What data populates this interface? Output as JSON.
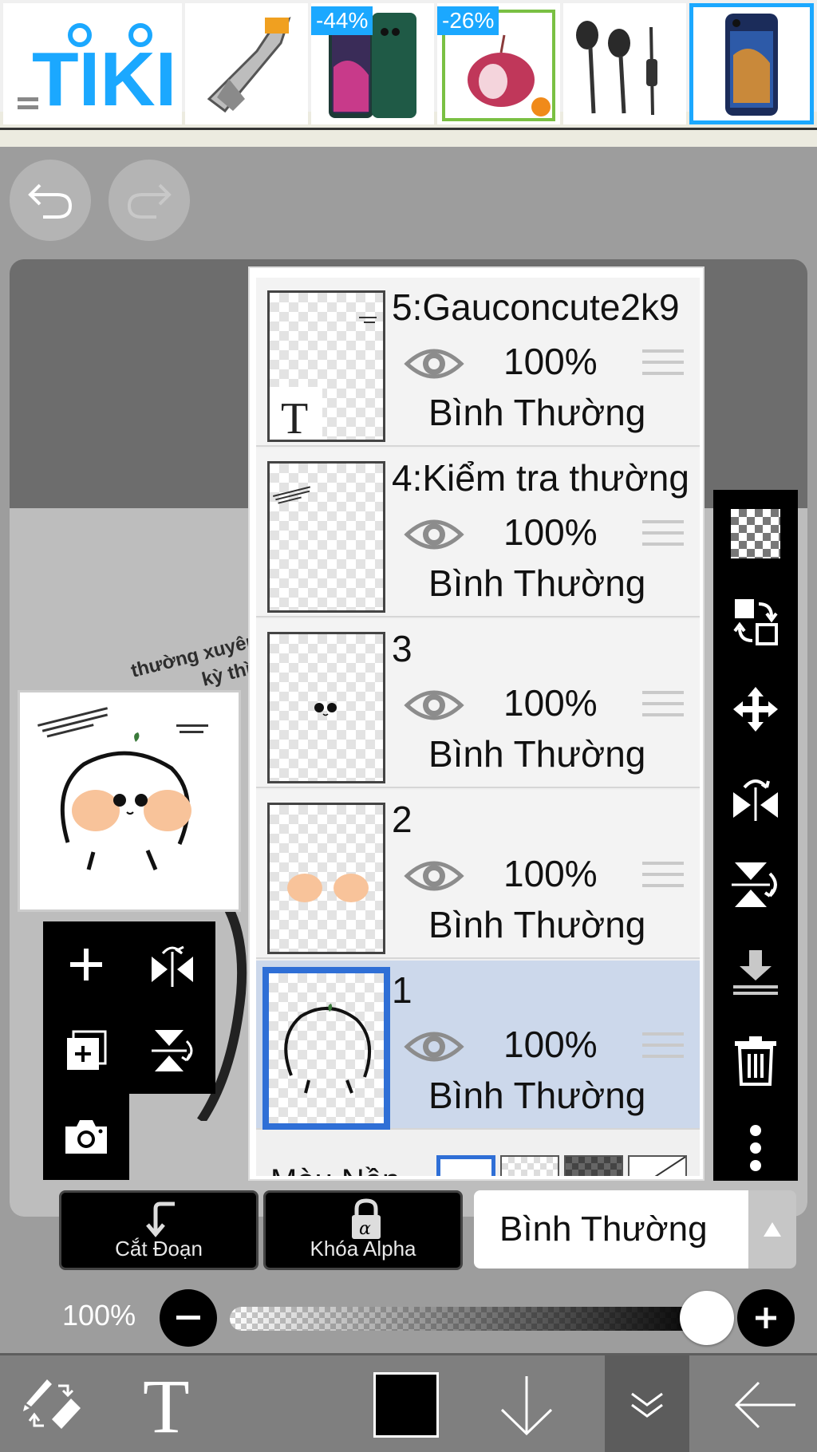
{
  "ad": {
    "brand": "TIKI",
    "products": [
      {
        "name": "tool-product",
        "badge": ""
      },
      {
        "name": "phone-product",
        "badge": "-44%"
      },
      {
        "name": "onion-product",
        "badge": "-26%"
      },
      {
        "name": "earphones-product",
        "badge": ""
      },
      {
        "name": "phone-case-product",
        "badge": ""
      }
    ]
  },
  "canvas": {
    "diag_text_1": "thường xuyên th",
    "diag_text_2": "kỳ thì ko c"
  },
  "layers": [
    {
      "name": "5:Gauconcute2k9",
      "opacity": "100%",
      "blend": "Bình Thường",
      "selected": false
    },
    {
      "name": "4:Kiểm tra thường",
      "opacity": "100%",
      "blend": "Bình Thường",
      "selected": false
    },
    {
      "name": "3",
      "opacity": "100%",
      "blend": "Bình Thường",
      "selected": false
    },
    {
      "name": "2",
      "opacity": "100%",
      "blend": "Bình Thường",
      "selected": false
    },
    {
      "name": "1",
      "opacity": "100%",
      "blend": "Bình Thường",
      "selected": true
    }
  ],
  "background": {
    "label": "Màu Nền"
  },
  "actions": {
    "clip_label": "Cắt Đoạn",
    "alpha_lock_label": "Khóa Alpha",
    "blend_mode": "Bình Thường"
  },
  "opacity": {
    "label": "100%",
    "value": 1.0
  },
  "colors": {
    "accent": "#2f6fd6",
    "tiki_blue": "#1ba8ff",
    "selected_layer_bg": "#ccd8eb",
    "current_color": "#000000"
  }
}
